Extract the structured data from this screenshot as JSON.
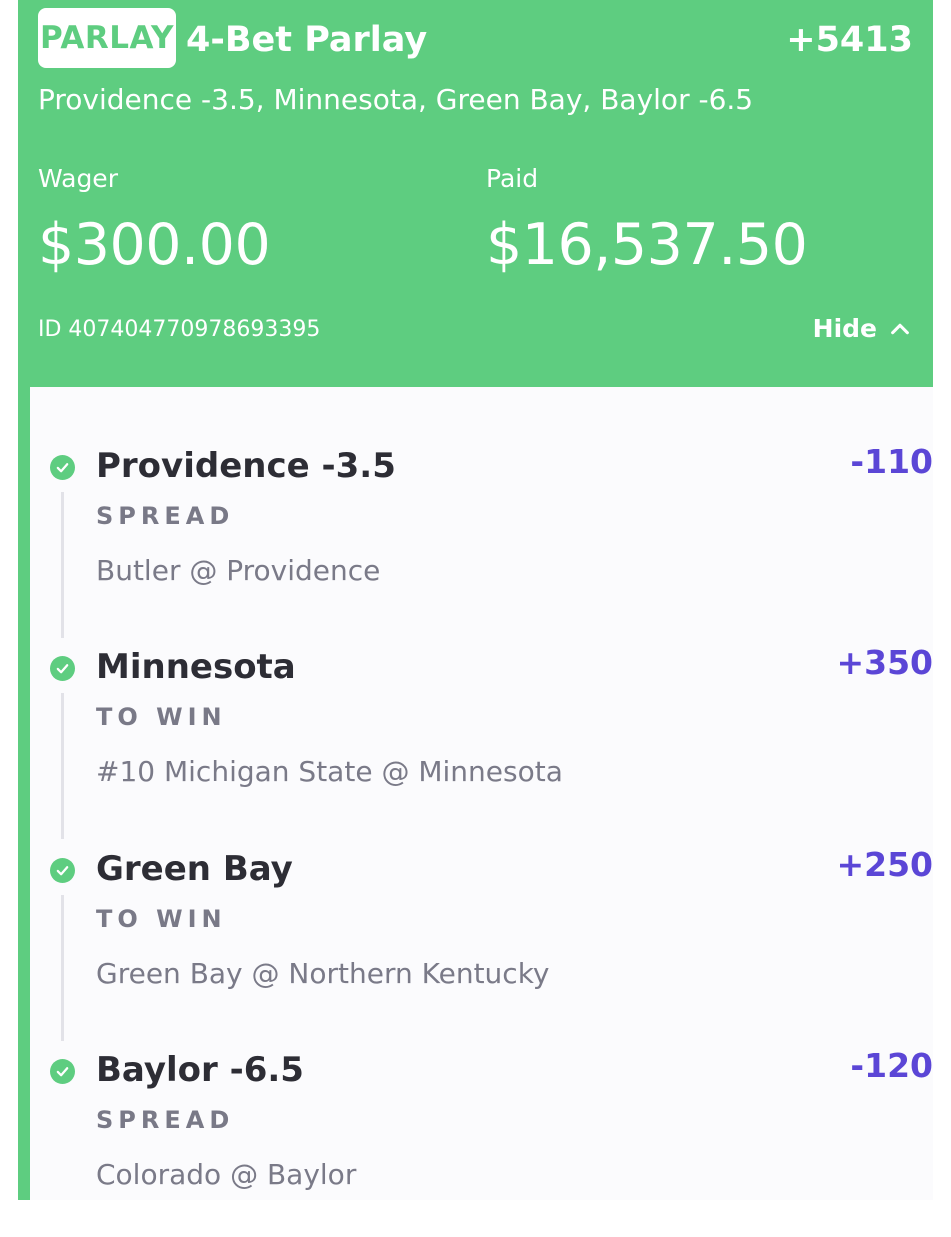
{
  "bet": {
    "badge": "PARLAY",
    "title": "4-Bet Parlay",
    "odds": "+5413",
    "summary": "Providence -3.5, Minnesota, Green Bay, Baylor -6.5",
    "wager_label": "Wager",
    "wager_value": "$300.00",
    "paid_label": "Paid",
    "paid_value": "$16,537.50",
    "id_text": "ID 407404770978693395",
    "toggle_label": "Hide"
  },
  "legs": [
    {
      "title": "Providence -3.5",
      "odds": "-110",
      "type": "SPREAD",
      "matchup": "Butler @ Providence",
      "status": "won"
    },
    {
      "title": "Minnesota",
      "odds": "+350",
      "type": "TO WIN",
      "matchup": "#10 Michigan State @ Minnesota",
      "status": "won"
    },
    {
      "title": "Green Bay",
      "odds": "+250",
      "type": "TO WIN",
      "matchup": "Green Bay @ Northern Kentucky",
      "status": "won"
    },
    {
      "title": "Baylor -6.5",
      "odds": "-120",
      "type": "SPREAD",
      "matchup": "Colorado @ Baylor",
      "status": "won"
    }
  ],
  "colors": {
    "accent_green": "#5ecd80",
    "odds_purple": "#5b46d6",
    "text_dark": "#2d2d35",
    "text_muted": "#7a7a88"
  },
  "icons": {
    "check": "check-circle-icon",
    "toggle": "chevron-up-icon"
  }
}
